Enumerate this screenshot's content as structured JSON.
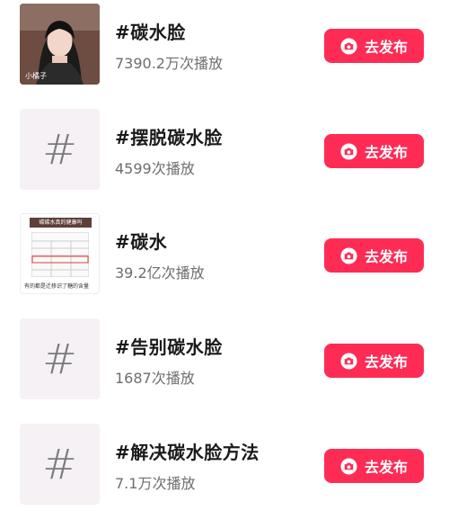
{
  "topics": [
    {
      "title": "#碳水脸",
      "plays": "7390.2万次播放",
      "button_label": "去发布",
      "thumbnail": "photo",
      "thumbnail_caption": "小橘子"
    },
    {
      "title": "#摆脱碳水脸",
      "plays": "4599次播放",
      "button_label": "去发布",
      "thumbnail": "hashtag-icon"
    },
    {
      "title": "#碳水",
      "plays": "39.2亿次播放",
      "button_label": "去发布",
      "thumbnail": "document",
      "thumbnail_header": "碳碳水真的健康吗",
      "thumbnail_caption": "有的都是迁移识了糖的含量"
    },
    {
      "title": "#告别碳水脸",
      "plays": "1687次播放",
      "button_label": "去发布",
      "thumbnail": "hashtag-icon"
    },
    {
      "title": "#解决碳水脸方法",
      "plays": "7.1万次播放",
      "button_label": "去发布",
      "thumbnail": "hashtag-icon"
    }
  ],
  "colors": {
    "accent": "#fe2c55",
    "placeholder_bg": "#f6f1f4",
    "title_text": "#1a1a1a",
    "meta_text": "#6e6e6e"
  }
}
